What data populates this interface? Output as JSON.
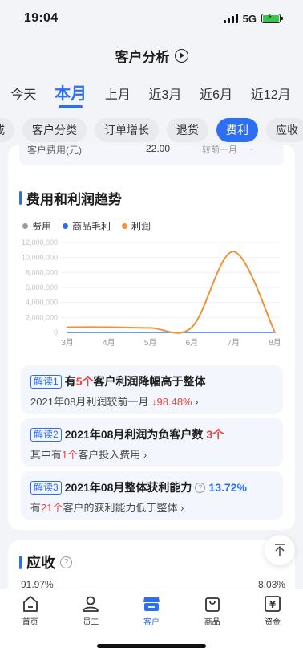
{
  "status": {
    "time": "19:04",
    "network": "5G"
  },
  "header": {
    "title": "客户分析"
  },
  "periods": [
    "今天",
    "本月",
    "上月",
    "近3月",
    "近6月",
    "近12月"
  ],
  "active_period": "本月",
  "chips": [
    "戒",
    "客户分类",
    "订单增长",
    "退货",
    "费利",
    "应收"
  ],
  "active_chip": "费利",
  "prev_row": {
    "label": "客户费用(元)",
    "value": "22.00",
    "compare": "较前一月",
    "change": "-"
  },
  "trend": {
    "title": "费用和利润趋势",
    "legend": [
      {
        "name": "费用",
        "color": "#999999"
      },
      {
        "name": "商品毛利",
        "color": "#2e6ff2"
      },
      {
        "name": "利润",
        "color": "#f0923a"
      }
    ]
  },
  "chart_data": {
    "type": "line",
    "categories": [
      "3月",
      "4月",
      "5月",
      "6月",
      "7月",
      "8月"
    ],
    "y_ticks": [
      "12,000,000",
      "10,000,000",
      "8,000,000",
      "6,000,000",
      "4,000,000",
      "2,000,000",
      "0"
    ],
    "ylim": [
      0,
      12000000
    ],
    "grid": true,
    "legend_position": "top-left",
    "series": [
      {
        "name": "费用",
        "color": "#999999",
        "values": [
          0,
          0,
          0,
          0,
          0,
          0
        ]
      },
      {
        "name": "商品毛利",
        "color": "#2e6ff2",
        "values": [
          0,
          0,
          0,
          0,
          0,
          0
        ]
      },
      {
        "name": "利润",
        "color": "#f0923a",
        "values": [
          700000,
          700000,
          600000,
          700000,
          10800000,
          0
        ]
      }
    ]
  },
  "insights": [
    {
      "tag": "解读1",
      "line1": [
        "有",
        "5个",
        "客户利润降幅高于整体"
      ],
      "line2": [
        "2021年08月利润较前一月",
        "↓98.48%",
        "›"
      ]
    },
    {
      "tag": "解读2",
      "line1": [
        "2021年08月利润为负客户数",
        "3个"
      ],
      "line2": [
        "其中有",
        "1个",
        "客户投入费用 ›"
      ]
    },
    {
      "tag": "解读3",
      "line1": [
        "2021年08月整体获利能力",
        "?",
        "13.72%"
      ],
      "line2": [
        "有",
        "21个",
        "客户的获利能力低于整体 ›"
      ]
    }
  ],
  "receivable": {
    "title": "应收",
    "left_pct": "91.97%",
    "right_pct": "8.03%"
  },
  "tabs": [
    {
      "label": "首页",
      "icon": "home-icon"
    },
    {
      "label": "员工",
      "icon": "person-icon"
    },
    {
      "label": "客户",
      "icon": "store-icon"
    },
    {
      "label": "商品",
      "icon": "bag-icon"
    },
    {
      "label": "资金",
      "icon": "yen-icon"
    }
  ],
  "active_tab": "客户"
}
